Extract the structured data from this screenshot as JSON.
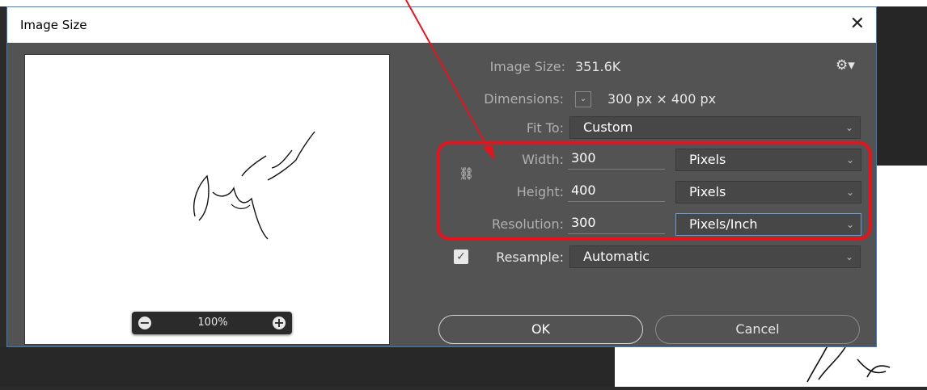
{
  "dialog": {
    "title": "Image Size",
    "close_glyph": "✕",
    "image_size_label": "Image Size:",
    "image_size_value": "351.6K",
    "gear_icon": "gear-icon",
    "dimensions_label": "Dimensions:",
    "dimensions_value": "300 px  ×  400 px",
    "fit_to_label": "Fit To:",
    "fit_to_value": "Custom",
    "width_label": "Width:",
    "width_value": "300",
    "width_unit": "Pixels",
    "height_label": "Height:",
    "height_value": "400",
    "height_unit": "Pixels",
    "resolution_label": "Resolution:",
    "resolution_value": "300",
    "resolution_unit": "Pixels/Inch",
    "resample_label": "Resample:",
    "resample_checked": true,
    "resample_value": "Automatic",
    "ok_label": "OK",
    "cancel_label": "Cancel"
  },
  "preview": {
    "zoom_value": "100%",
    "zoom_out_glyph": "−",
    "zoom_in_glyph": "+"
  },
  "colors": {
    "dialog_bg": "#535353",
    "annotation": "#e2141e"
  }
}
